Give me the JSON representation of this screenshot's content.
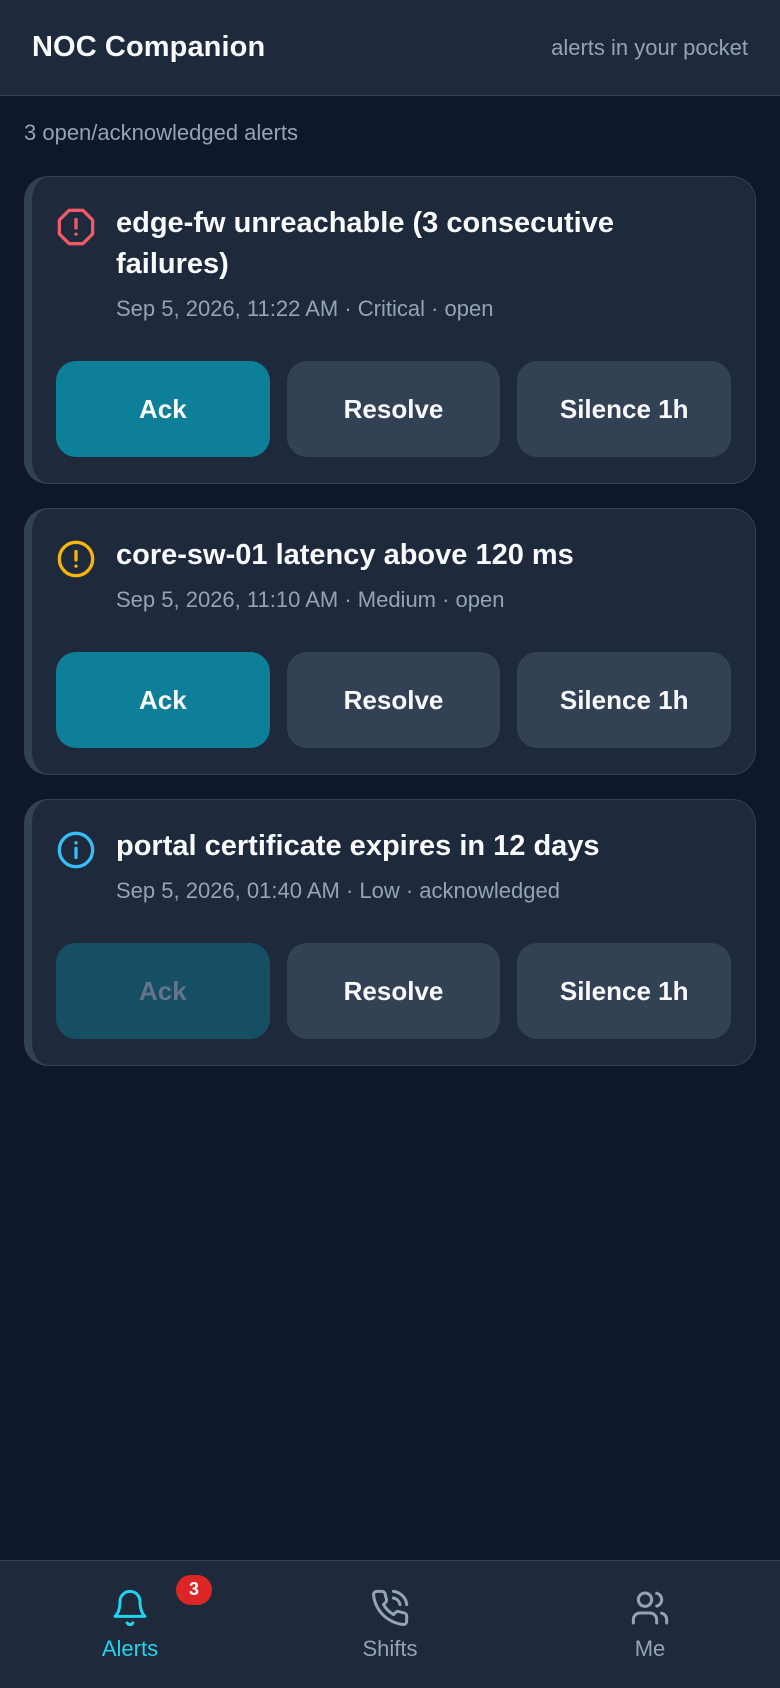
{
  "header": {
    "title": "NOC Companion",
    "tagline": "alerts in your pocket"
  },
  "summary": "3 open/acknowledged alerts",
  "colors": {
    "critical": "#f05a66",
    "medium": "#f5b50a",
    "low": "#38bdf8",
    "accent": "#22d3ee",
    "primary_button": "#0e7f98",
    "badge": "#dc2626"
  },
  "alerts": [
    {
      "title": "edge-fw unreachable (3 consecutive failures)",
      "meta": "Sep 5, 2026, 11:22 AM · Critical · open",
      "icon": "octagon-alert-icon",
      "ack_label": "Ack",
      "resolve_label": "Resolve",
      "silence_label": "Silence 1h"
    },
    {
      "title": "core-sw-01 latency above 120 ms",
      "meta": "Sep 5, 2026, 11:10 AM · Medium · open",
      "icon": "circle-alert-icon",
      "ack_label": "Ack",
      "resolve_label": "Resolve",
      "silence_label": "Silence 1h"
    },
    {
      "title": "portal certificate expires in 12 days",
      "meta": "Sep 5, 2026, 01:40 AM · Low · acknowledged",
      "icon": "info-icon",
      "ack_label": "Ack",
      "resolve_label": "Resolve",
      "silence_label": "Silence 1h"
    }
  ],
  "nav": {
    "items": [
      {
        "label": "Alerts",
        "icon": "bell-icon",
        "badge": "3"
      },
      {
        "label": "Shifts",
        "icon": "phone-call-icon"
      },
      {
        "label": "Me",
        "icon": "users-icon"
      }
    ]
  }
}
